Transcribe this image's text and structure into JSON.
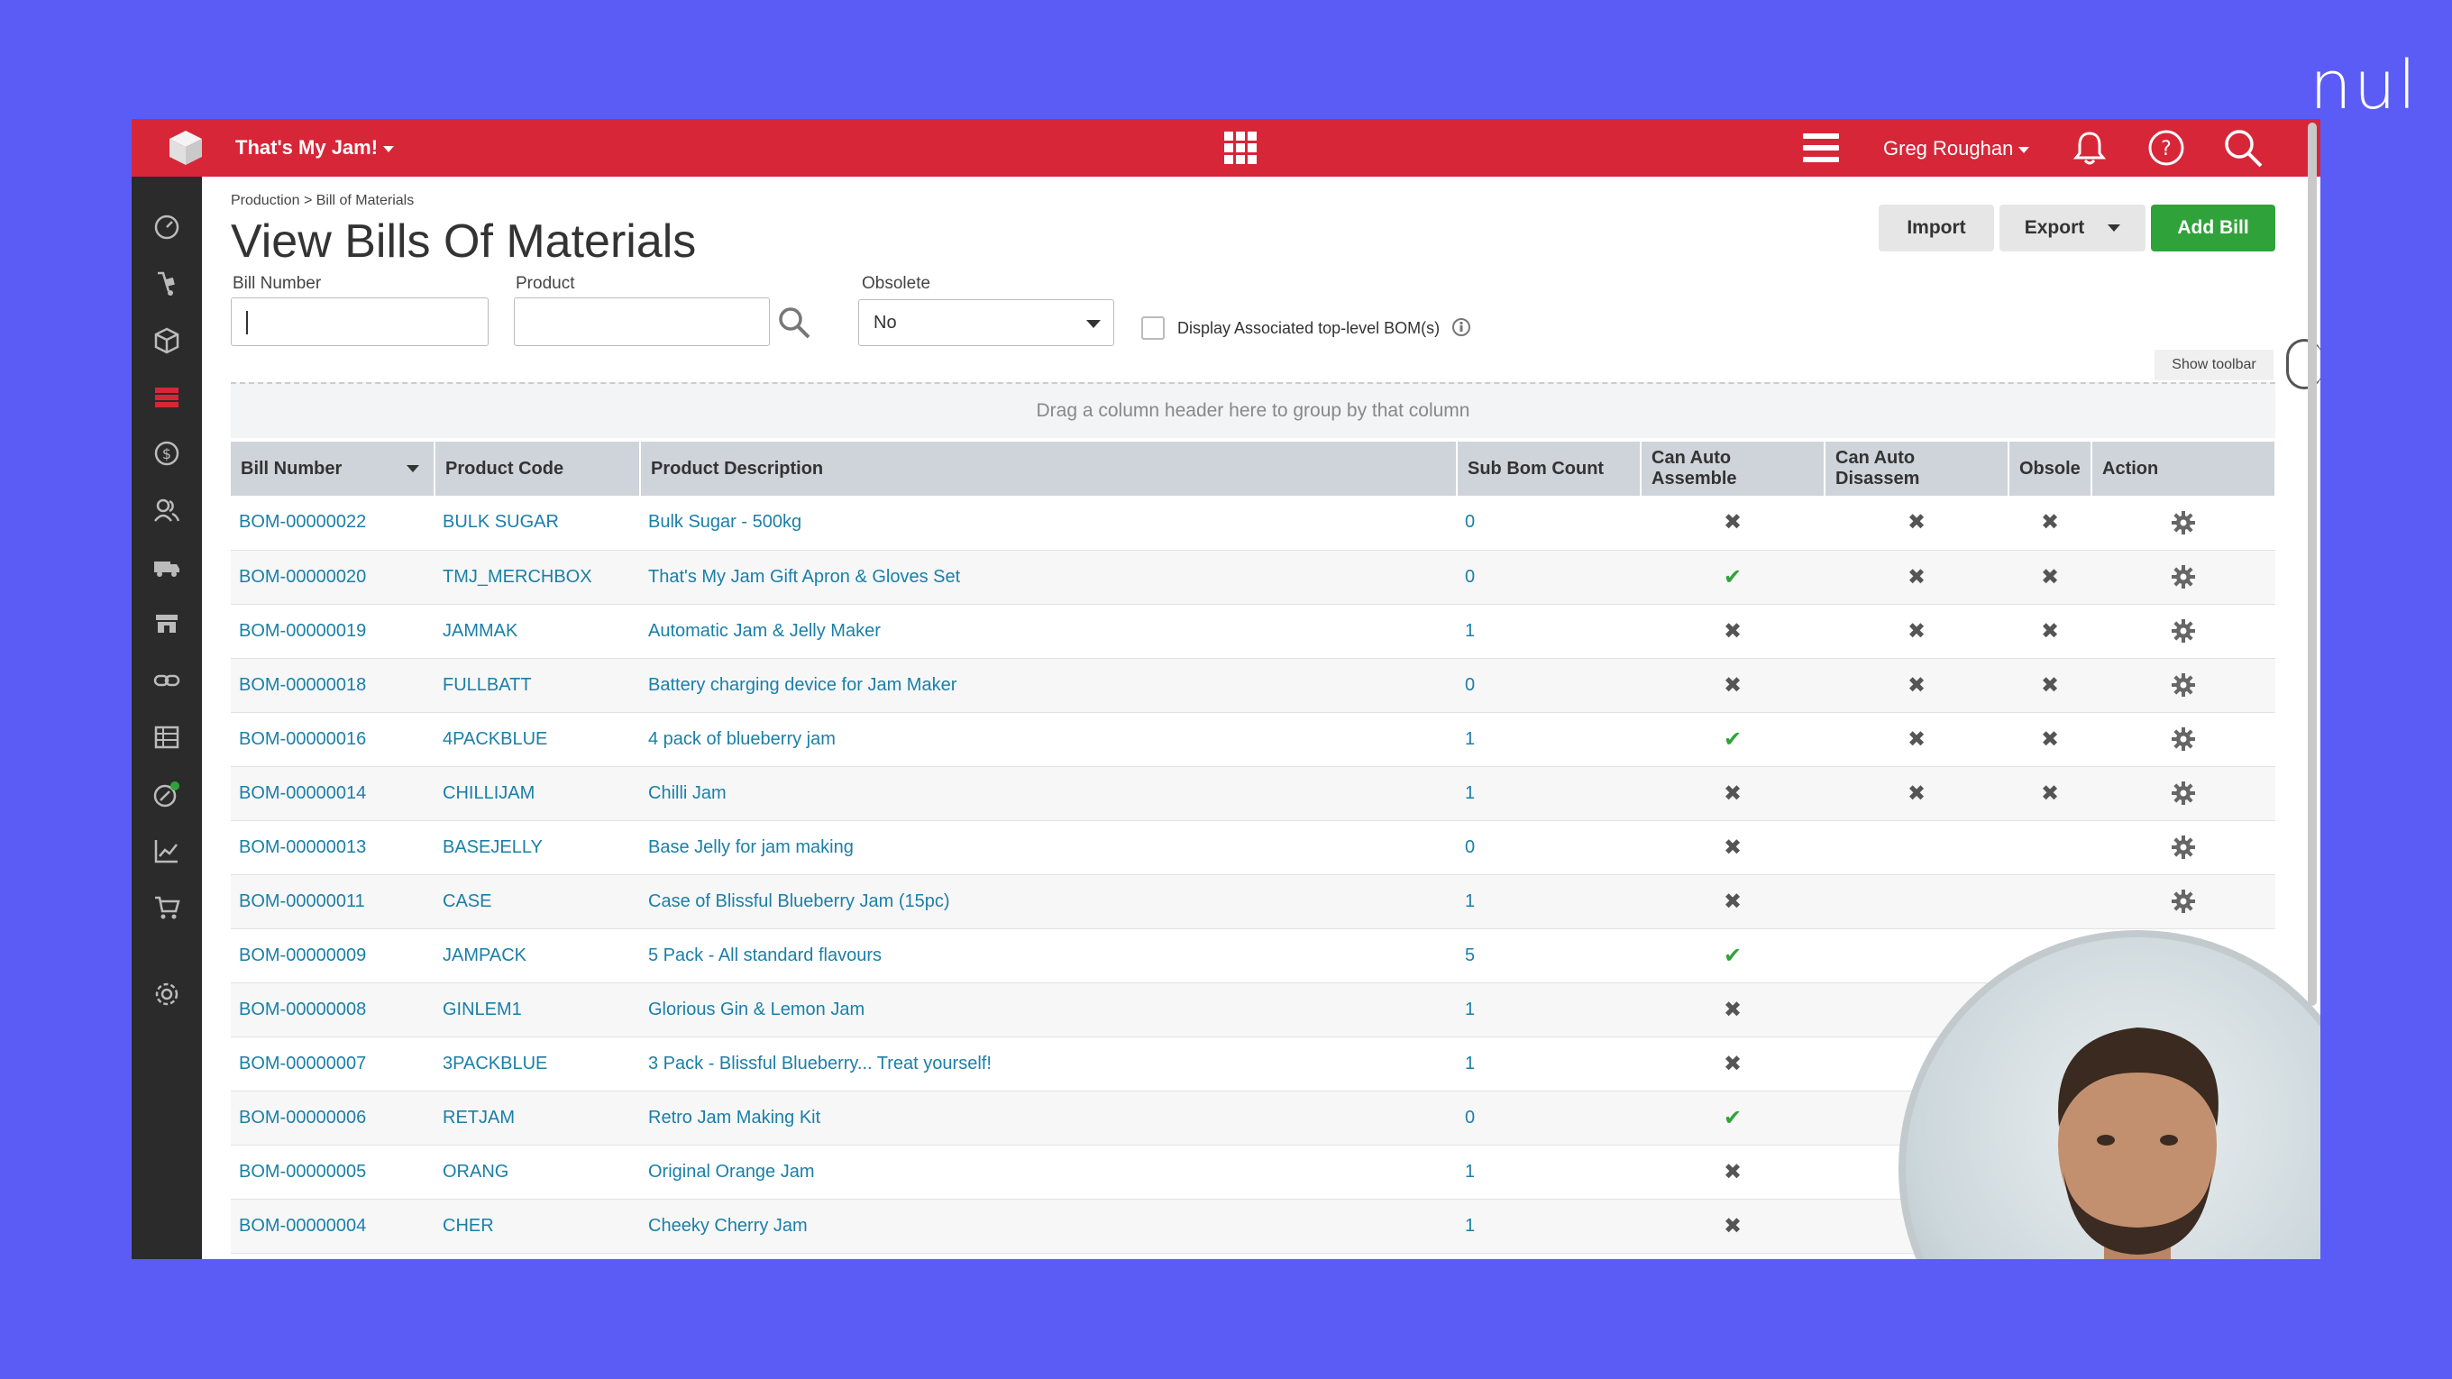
{
  "brand_mark": "nul",
  "topbar": {
    "company": "That's My Jam!",
    "user": "Greg Roughan"
  },
  "breadcrumb": "Production > Bill of Materials",
  "page_title": "View Bills Of Materials",
  "buttons": {
    "import": "Import",
    "export": "Export",
    "add_bill": "Add Bill"
  },
  "filters": {
    "bill_number_label": "Bill Number",
    "bill_number_value": "",
    "product_label": "Product",
    "product_value": "",
    "obsolete_label": "Obsolete",
    "obsolete_value": "No",
    "display_associated_label": "Display Associated top-level BOM(s)"
  },
  "show_toolbar": "Show toolbar",
  "group_hint": "Drag a column header here to group by that column",
  "table": {
    "columns": [
      "Bill Number",
      "Product Code",
      "Product Description",
      "Sub Bom Count",
      "Can Auto Assemble",
      "Can Auto Disassem",
      "Obsole",
      "Action"
    ],
    "rows": [
      {
        "bill": "BOM-00000022",
        "code": "BULK SUGAR",
        "desc": "Bulk Sugar - 500kg",
        "count": "0",
        "assemble": "x",
        "disassemble": "x",
        "obsolete": "x"
      },
      {
        "bill": "BOM-00000020",
        "code": "TMJ_MERCHBOX",
        "desc": "That's My Jam Gift Apron & Gloves Set",
        "count": "0",
        "assemble": "check",
        "disassemble": "x",
        "obsolete": "x"
      },
      {
        "bill": "BOM-00000019",
        "code": "JAMMAK",
        "desc": "Automatic Jam & Jelly Maker",
        "count": "1",
        "assemble": "x",
        "disassemble": "x",
        "obsolete": "x"
      },
      {
        "bill": "BOM-00000018",
        "code": "FULLBATT",
        "desc": "Battery charging device for Jam Maker",
        "count": "0",
        "assemble": "x",
        "disassemble": "x",
        "obsolete": "x"
      },
      {
        "bill": "BOM-00000016",
        "code": "4PACKBLUE",
        "desc": "4 pack of blueberry jam",
        "count": "1",
        "assemble": "check",
        "disassemble": "x",
        "obsolete": "x"
      },
      {
        "bill": "BOM-00000014",
        "code": "CHILLIJAM",
        "desc": "Chilli Jam",
        "count": "1",
        "assemble": "x",
        "disassemble": "x",
        "obsolete": "x"
      },
      {
        "bill": "BOM-00000013",
        "code": "BASEJELLY",
        "desc": "Base Jelly for jam making",
        "count": "0",
        "assemble": "x",
        "disassemble": "",
        "obsolete": ""
      },
      {
        "bill": "BOM-00000011",
        "code": "CASE",
        "desc": "Case of Blissful Blueberry Jam (15pc)",
        "count": "1",
        "assemble": "x",
        "disassemble": "",
        "obsolete": ""
      },
      {
        "bill": "BOM-00000009",
        "code": "JAMPACK",
        "desc": "5 Pack - All standard flavours",
        "count": "5",
        "assemble": "check",
        "disassemble": "",
        "obsolete": ""
      },
      {
        "bill": "BOM-00000008",
        "code": "GINLEM1",
        "desc": "Glorious Gin & Lemon Jam",
        "count": "1",
        "assemble": "x",
        "disassemble": "",
        "obsolete": ""
      },
      {
        "bill": "BOM-00000007",
        "code": "3PACKBLUE",
        "desc": "3 Pack - Blissful Blueberry... Treat yourself!",
        "count": "1",
        "assemble": "x",
        "disassemble": "",
        "obsolete": ""
      },
      {
        "bill": "BOM-00000006",
        "code": "RETJAM",
        "desc": "Retro Jam Making Kit",
        "count": "0",
        "assemble": "check",
        "disassemble": "",
        "obsolete": ""
      },
      {
        "bill": "BOM-00000005",
        "code": "ORANG",
        "desc": "Original Orange Jam",
        "count": "1",
        "assemble": "x",
        "disassemble": "",
        "obsolete": ""
      },
      {
        "bill": "BOM-00000004",
        "code": "CHER",
        "desc": "Cheeky Cherry Jam",
        "count": "1",
        "assemble": "x",
        "disassemble": "",
        "obsolete": ""
      }
    ]
  },
  "colors": {
    "topbar": "#d72638",
    "sidebar": "#2b2b2b",
    "accent_green": "#2fa33a",
    "link": "#1a7fa8",
    "background": "#5b5cf6"
  }
}
